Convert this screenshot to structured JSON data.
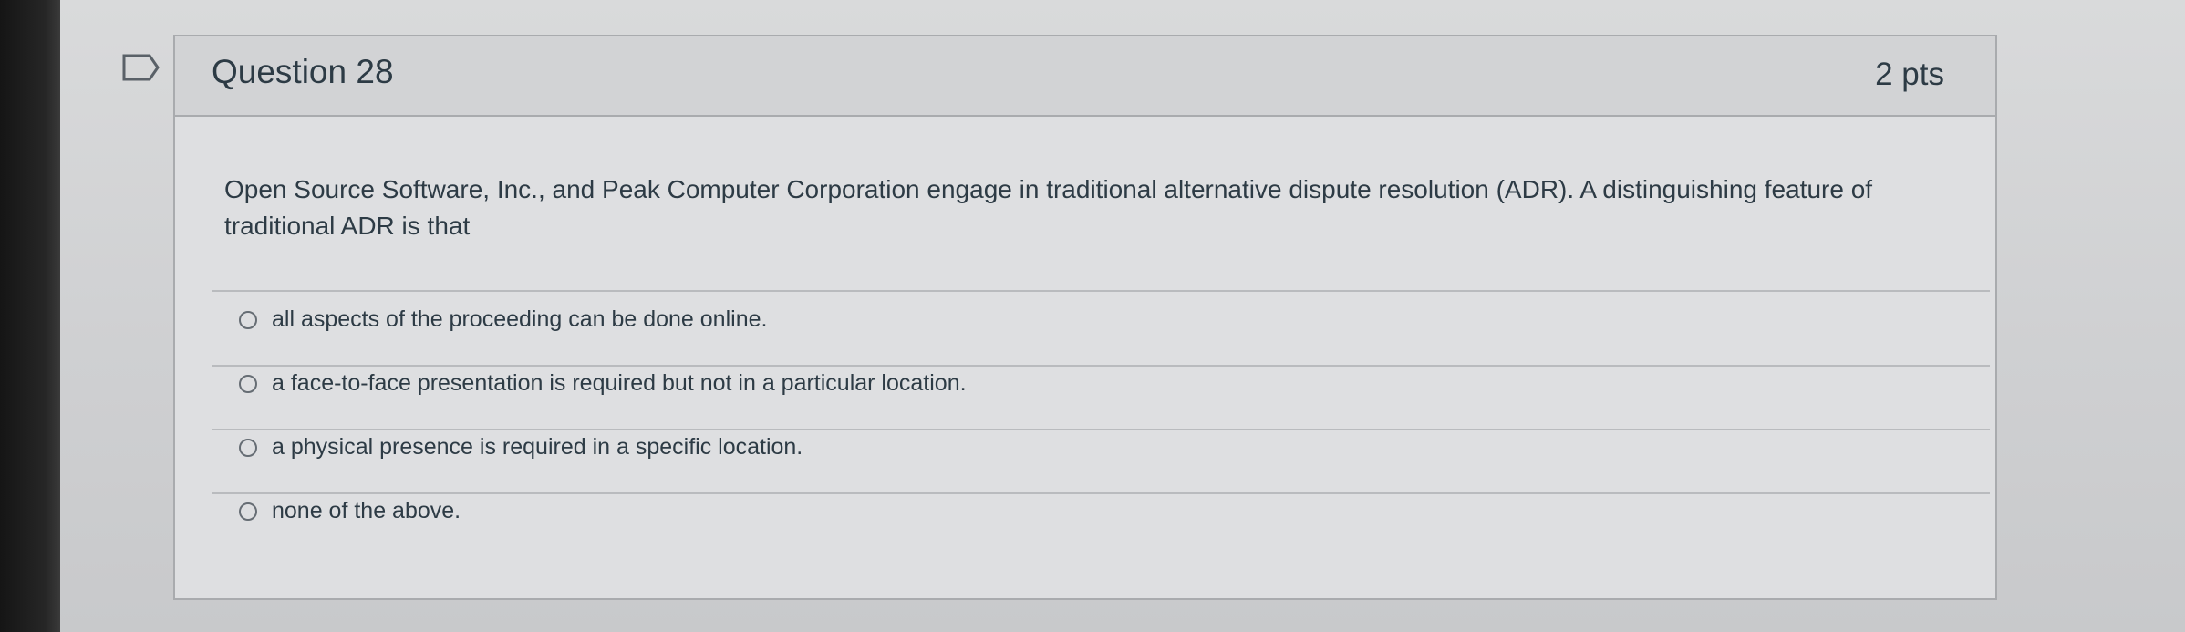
{
  "question": {
    "title": "Question 28",
    "points": "2 pts",
    "text": "Open Source Software, Inc., and Peak Computer Corporation engage in traditional alternative dispute resolution (ADR). A distinguishing feature of traditional ADR is that",
    "options": [
      "all aspects of the proceeding can be done online.",
      "a face-to-face presentation is required but not in a particular location.",
      "a physical presence is required in a specific location.",
      "none of the above."
    ]
  },
  "icons": {
    "flag": "flag-icon",
    "radio": "radio-button-icon"
  },
  "colors": {
    "text": "#2d3b45",
    "header_background": "#d2d3d5",
    "card_background": "#dedfe1",
    "border": "#a9abae"
  }
}
